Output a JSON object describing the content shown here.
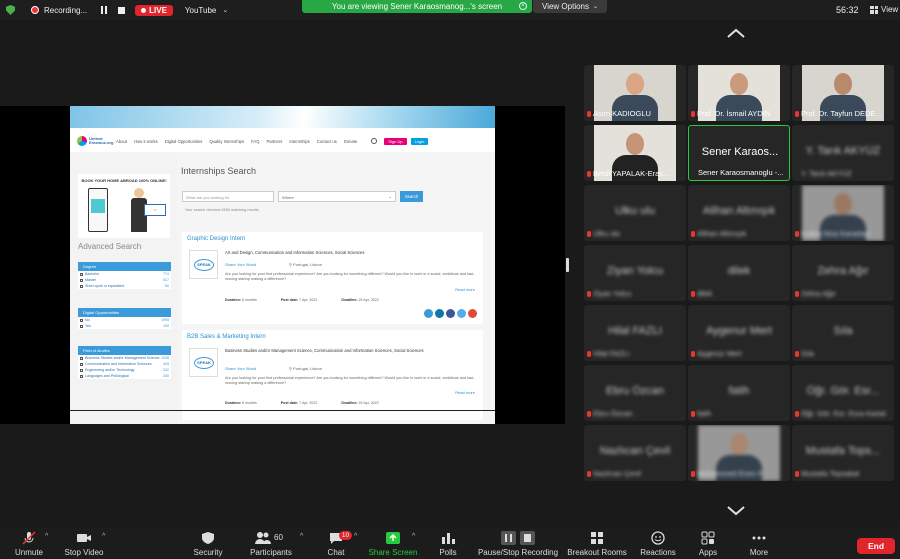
{
  "topbar": {
    "recording_label": "Recording...",
    "live_badge": "LIVE",
    "stream_target": "YouTube",
    "viewing_banner": "You are viewing Sener Karaosmanog...'s screen",
    "view_options": "View Options",
    "timer": "56:32",
    "view_label": "View"
  },
  "shared_page": {
    "nav": {
      "logo_text": "Unitest Erasmus.org",
      "links": [
        "About",
        "How it works",
        "Digital Opportunities",
        "Quality Internships",
        "FAQ",
        "Partners",
        "Internships",
        "Contact us",
        "Donate"
      ],
      "signup": "Sign Up",
      "login": "Login"
    },
    "ad_title": "BOOK YOUR HOME ABROAD 100% ONLINE!",
    "advanced_search": "Advanced Search",
    "filters": [
      {
        "heading": "Degree",
        "rows": [
          {
            "label": "Bachelor",
            "count": "774"
          },
          {
            "label": "Master",
            "count": "517"
          },
          {
            "label": "Short cycle or equivalent",
            "count": "60"
          }
        ]
      },
      {
        "heading": "Digital Opportunities",
        "rows": [
          {
            "label": "No",
            "count": "1995"
          },
          {
            "label": "Yes",
            "count": "159"
          }
        ]
      },
      {
        "heading": "Field of studies",
        "rows": [
          {
            "label": "Business Studies and/or Management Science",
            "count": "1048"
          },
          {
            "label": "Communication and Information Sciences",
            "count": "449"
          },
          {
            "label": "Engineering and/or Technology",
            "count": "342"
          },
          {
            "label": "Languages and Philological",
            "count": "340"
          }
        ]
      }
    ],
    "search": {
      "title": "Internships Search",
      "placeholder": "What are you looking for",
      "where": "Where",
      "button": "Search",
      "result_text": "Your search returned 2650 matching results."
    },
    "listings": [
      {
        "title": "Graphic Design Intern",
        "categories": "Art and Design, Communication and Information Sciences, Social Sciences",
        "company": "Share Your World",
        "location": "Portugal, Lisbon",
        "description": "Are you looking for your first professional experience? Are you looking for something different? Would you like to work in a social, ambitious and fast-moving startup making a difference?",
        "read_more": "Read more",
        "duration_label": "Duration:",
        "duration": "6 months",
        "post_label": "Post date:",
        "post_date": "7 Apr, 2022",
        "deadline_label": "Deadline:",
        "deadline": "25 Apr, 2022",
        "logo_text": "SPEAK"
      },
      {
        "title": "B2B Sales & Marketing Intern",
        "categories": "Business Studies and/or Management Science, Communication and Information Sciences, Social Sciences",
        "company": "Share Your World",
        "location": "Portugal, Lisbon",
        "description": "Are you looking for your first professional experience? Are you looking for something different? Would you like to work in a social, ambitious and fast-moving startup making a difference?",
        "read_more": "Read more",
        "duration_label": "Duration:",
        "duration": "6 months",
        "post_label": "Post date:",
        "post_date": "7 Apr, 2022",
        "deadline_label": "Deadline:",
        "deadline": "25 Apr, 2022",
        "logo_text": "SPEAK"
      }
    ]
  },
  "participants": [
    {
      "name": "Asım KADIOGLU",
      "video": true,
      "muted": true
    },
    {
      "name": "Prof. Dr. İsmail AYDIN",
      "video": true,
      "muted": true
    },
    {
      "name": "Prof. Dr. Tayfun DEDE...",
      "video": true,
      "muted": true
    },
    {
      "name": "Betül YAPALAK-Eras...",
      "video": true,
      "muted": true
    },
    {
      "name": "Sener Karaosmanoglu -...",
      "big": "Sener Karaos...",
      "video": false,
      "muted": false,
      "active": true
    },
    {
      "name": "Y. Tarık AKYÜZ",
      "big": "Y. Tarık AKYÜZ",
      "video": false,
      "muted": false
    },
    {
      "name": "Ulku ulu",
      "big": "Ulku ulu",
      "video": false,
      "muted": true
    },
    {
      "name": "Alihan Altınışık",
      "big": "Alihan Altınışık",
      "video": false,
      "muted": true
    },
    {
      "name": "Kubra Nisa Karadayı",
      "video": true,
      "muted": true
    },
    {
      "name": "Ziyan Yolcu",
      "big": "Ziyan Yolcu",
      "video": false,
      "muted": true
    },
    {
      "name": "dilek",
      "big": "dilek",
      "video": false,
      "muted": true
    },
    {
      "name": "Zehra Ağır",
      "big": "Zehra Ağır",
      "video": false,
      "muted": true
    },
    {
      "name": "Hilal FAZLI",
      "big": "Hilal FAZLI",
      "video": false,
      "muted": true
    },
    {
      "name": "Aygenur Mert",
      "big": "Aygenur Mert",
      "video": false,
      "muted": true
    },
    {
      "name": "Sıla",
      "big": "Sıla",
      "video": false,
      "muted": true
    },
    {
      "name": "Ebru Özcan",
      "big": "Ebru Özcan",
      "video": false,
      "muted": true
    },
    {
      "name": "fatih",
      "big": "fatih",
      "video": false,
      "muted": true
    },
    {
      "name": "Öğr. Gör. Esr. Esra Kartal",
      "big": "Öğr. Gör. Esr...",
      "video": false,
      "muted": true
    },
    {
      "name": "Nazlıcan Çevil",
      "big": "Nazlıcan Çevil",
      "video": false,
      "muted": true
    },
    {
      "name": "Muhammed Enes P.",
      "video": true,
      "muted": true
    },
    {
      "name": "Mustafa Topsakal",
      "big": "Mustafa Tops...",
      "video": false,
      "muted": true
    }
  ],
  "toolbar": {
    "unmute": "Unmute",
    "stop_video": "Stop Video",
    "security": "Security",
    "participants": "Participants",
    "participants_count": "60",
    "chat": "Chat",
    "chat_badge": "10",
    "share_screen": "Share Screen",
    "polls": "Polls",
    "pause_recording": "Pause/Stop Recording",
    "breakout": "Breakout Rooms",
    "reactions": "Reactions",
    "apps": "Apps",
    "more": "More",
    "end": "End"
  },
  "colors": {
    "share_green": "#27c93f",
    "end_red": "#e0252c",
    "live_red": "#e0252c",
    "banner_green": "#28a745",
    "site_blue": "#3b9ad9",
    "site_pink": "#e6007e"
  }
}
